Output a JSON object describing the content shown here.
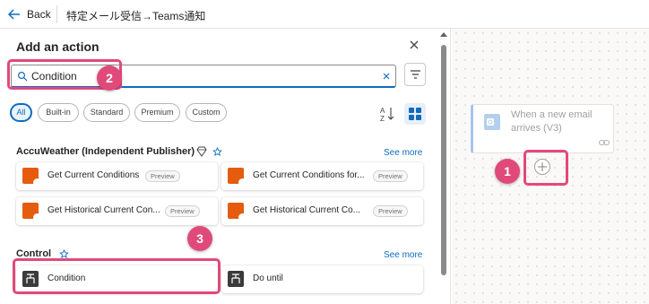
{
  "topbar": {
    "back_label": "Back",
    "flow_title": "特定メール受信→Teams通知"
  },
  "panel": {
    "title": "Add an action",
    "search": {
      "value": "Condition",
      "placeholder": "Search"
    },
    "filters": [
      "All",
      "Built-in",
      "Standard",
      "Premium",
      "Custom"
    ],
    "active_filter": "All"
  },
  "sections": [
    {
      "title": "AccuWeather (Independent Publisher)",
      "see_more": "See more",
      "actions": [
        {
          "label": "Get Current Conditions",
          "badge": "Preview"
        },
        {
          "label": "Get Current Conditions for...",
          "badge": "Preview"
        },
        {
          "label": "Get Historical Current Con...",
          "badge": "Preview"
        },
        {
          "label": "Get Historical Current Co...",
          "badge": "Preview"
        }
      ]
    },
    {
      "title": "Control",
      "see_more": "See more",
      "actions": [
        {
          "label": "Condition"
        },
        {
          "label": "Do until"
        }
      ]
    }
  ],
  "canvas": {
    "trigger_title": "When a new email arrives (V3)"
  },
  "annotations": [
    "1",
    "2",
    "3"
  ],
  "colors": {
    "accent": "#0f6cbd",
    "annotation": "#e04a7a",
    "accuweather": "#e55c0e",
    "control": "#3b3b3b"
  }
}
